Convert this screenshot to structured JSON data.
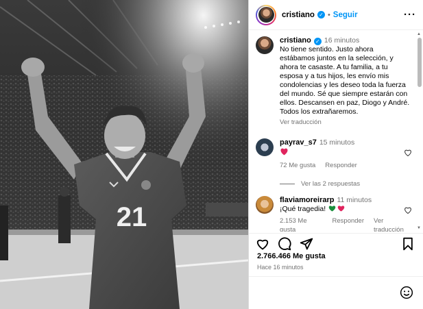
{
  "header": {
    "username": "cristiano",
    "separator": "•",
    "follow_label": "Seguir",
    "more_label": "···"
  },
  "comments": [
    {
      "username": "cristiano",
      "time": "16 minutos",
      "text_lines": [
        "No tiene sentido. Justo ahora",
        "estábamos juntos en la selección, y",
        "ahora te casaste. A tu familia, a tu",
        "esposa y a tus hijos, les envío mis",
        "condolencias y les deseo toda la fuerza",
        "del mundo. Sé que siempre estarán con",
        "ellos. Descansen en paz, Diogo y André.",
        "Todos los extrañaremos."
      ],
      "translate_label": "Ver traducción"
    },
    {
      "username": "payrav_s7",
      "time": "15 minutos",
      "likes_label": "72 Me gusta",
      "reply_label": "Responder",
      "view_replies_label": "Ver las 2 respuestas"
    },
    {
      "username": "flaviamoreirarp",
      "time": "11 minutos",
      "text": "¡Qué tragedia!",
      "likes_label": "2.153 Me gusta",
      "reply_label": "Responder",
      "translate_label": "Ver traducción"
    }
  ],
  "post": {
    "likes_count": "2.766.466 Me gusta",
    "posted_ago": "Hace 16 minutos",
    "jersey_number": "21"
  },
  "icons": {
    "like": "heart-icon",
    "comment": "comment-icon",
    "share": "share-icon",
    "save": "bookmark-icon",
    "emoji": "emoji-icon",
    "verified": "verified-badge-icon"
  },
  "colors": {
    "link_blue": "#0095f6",
    "heart_red": "#ed4956",
    "muted": "#737373"
  }
}
